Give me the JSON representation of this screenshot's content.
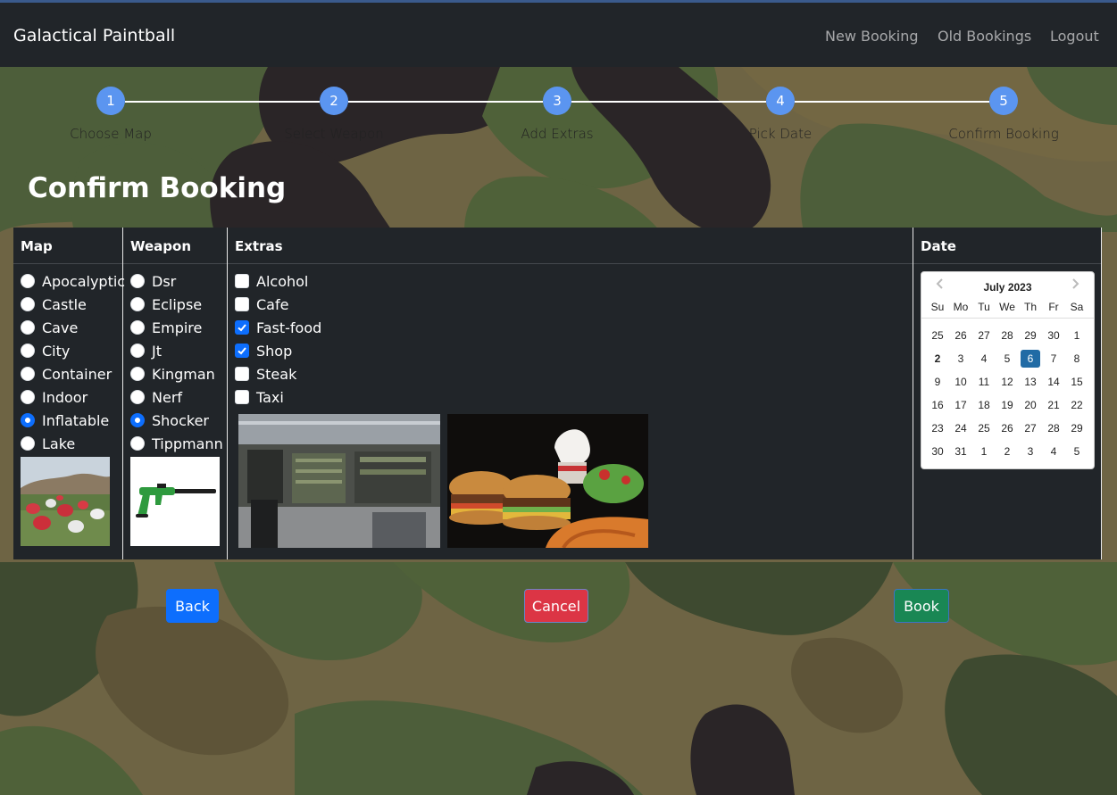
{
  "navbar": {
    "brand": "Galactical Paintball",
    "links": [
      "New Booking",
      "Old Bookings",
      "Logout"
    ]
  },
  "steps": [
    {
      "number": "1",
      "label": "Choose Map"
    },
    {
      "number": "2",
      "label": "Select Weapon"
    },
    {
      "number": "3",
      "label": "Add Extras"
    },
    {
      "number": "4",
      "label": "Pick Date"
    },
    {
      "number": "5",
      "label": "Confirm Booking"
    }
  ],
  "page": {
    "title": "Confirm Booking"
  },
  "table": {
    "headers": {
      "map": "Map",
      "weapon": "Weapon",
      "extras": "Extras",
      "date": "Date"
    }
  },
  "maps": [
    {
      "label": "Apocalyptic",
      "selected": false
    },
    {
      "label": "Castle",
      "selected": false
    },
    {
      "label": "Cave",
      "selected": false
    },
    {
      "label": "City",
      "selected": false
    },
    {
      "label": "Container",
      "selected": false
    },
    {
      "label": "Indoor",
      "selected": false
    },
    {
      "label": "Inflatable",
      "selected": true
    },
    {
      "label": "Lake",
      "selected": false
    }
  ],
  "weapons": [
    {
      "label": "Dsr",
      "selected": false
    },
    {
      "label": "Eclipse",
      "selected": false
    },
    {
      "label": "Empire",
      "selected": false
    },
    {
      "label": "Jt",
      "selected": false
    },
    {
      "label": "Kingman",
      "selected": false
    },
    {
      "label": "Nerf",
      "selected": false
    },
    {
      "label": "Shocker",
      "selected": true
    },
    {
      "label": "Tippmann",
      "selected": false
    }
  ],
  "extras": [
    {
      "label": "Alcohol",
      "checked": false
    },
    {
      "label": "Cafe",
      "checked": false
    },
    {
      "label": "Fast-food",
      "checked": true
    },
    {
      "label": "Shop",
      "checked": true
    },
    {
      "label": "Steak",
      "checked": false
    },
    {
      "label": "Taxi",
      "checked": false
    }
  ],
  "calendar": {
    "month": "July 2023",
    "weekdays": [
      "Su",
      "Mo",
      "Tu",
      "We",
      "Th",
      "Fr",
      "Sa"
    ],
    "weeks": [
      [
        "25",
        "26",
        "27",
        "28",
        "29",
        "30",
        "1"
      ],
      [
        "2",
        "3",
        "4",
        "5",
        "6",
        "7",
        "8"
      ],
      [
        "9",
        "10",
        "11",
        "12",
        "13",
        "14",
        "15"
      ],
      [
        "16",
        "17",
        "18",
        "19",
        "20",
        "21",
        "22"
      ],
      [
        "23",
        "24",
        "25",
        "26",
        "27",
        "28",
        "29"
      ],
      [
        "30",
        "31",
        "1",
        "2",
        "3",
        "4",
        "5"
      ]
    ],
    "today": "2",
    "selected": "6"
  },
  "buttons": {
    "back": "Back",
    "cancel": "Cancel",
    "book": "Book"
  },
  "colors": {
    "navbar": "#212529",
    "step": "#5b95f0",
    "back": "#0d6efd",
    "cancel": "#dc3545",
    "book": "#198754"
  }
}
